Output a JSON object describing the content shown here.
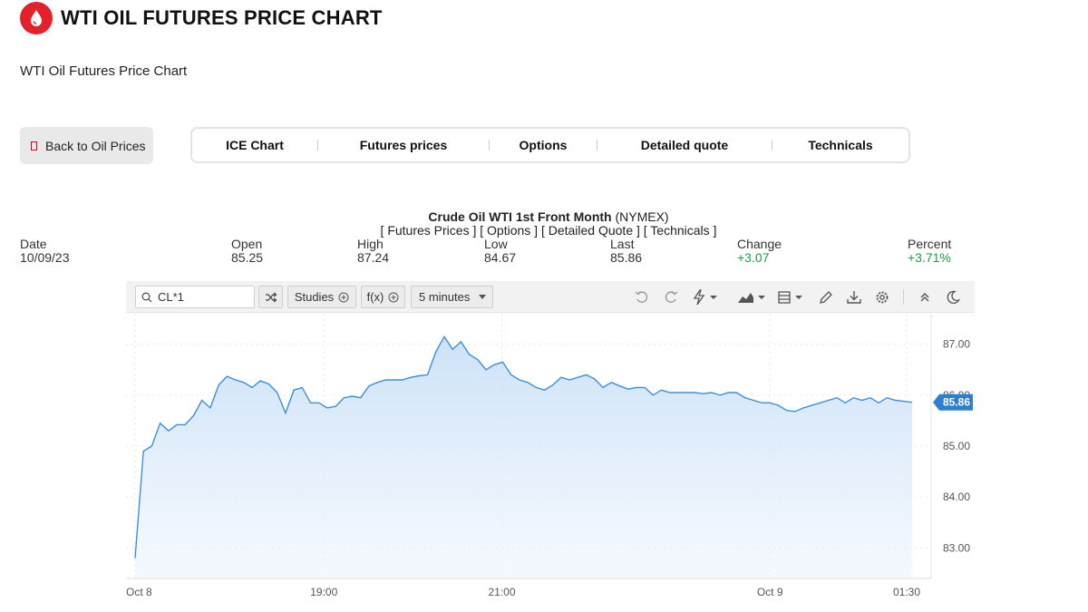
{
  "header": {
    "title": "WTI OIL FUTURES PRICE CHART",
    "subtitle": "WTI Oil Futures Price Chart",
    "logo_icon": "oil-drop-icon",
    "brand_color": "#e4202b"
  },
  "back_button": {
    "label": "Back to Oil Prices"
  },
  "tabs": [
    {
      "label": "ICE Chart"
    },
    {
      "label": "Futures prices"
    },
    {
      "label": "Options"
    },
    {
      "label": "Detailed quote"
    },
    {
      "label": "Technicals"
    }
  ],
  "quote": {
    "name": "Crude Oil WTI 1st Front Month",
    "exchange": "(NYMEX)",
    "links": "[ Futures Prices ] [ Options ] [ Detailed Quote ] [ Technicals ]",
    "columns": [
      {
        "label": "Date",
        "value": "10/09/23"
      },
      {
        "label": "Open",
        "value": "85.25"
      },
      {
        "label": "High",
        "value": "87.24"
      },
      {
        "label": "Low",
        "value": "84.67"
      },
      {
        "label": "Last",
        "value": "85.86"
      },
      {
        "label": "Change",
        "value": "+3.07"
      },
      {
        "label": "Percent",
        "value": "+3.71%"
      }
    ],
    "positive_color": "#1e9e4a"
  },
  "toolbar": {
    "symbol": "CL*1",
    "studies_label": "Studies",
    "fx_label": "f(x)",
    "interval_label": "5 minutes",
    "icons": [
      "search-icon",
      "shuffle-icon",
      "plus-circle-icon",
      "chevron-down-icon",
      "undo-icon",
      "redo-icon",
      "bolt-icon",
      "area-chart-icon",
      "template-icon",
      "pencil-icon",
      "download-icon",
      "gear-icon",
      "collapse-icon",
      "moon-icon"
    ]
  },
  "chart_data": {
    "type": "area",
    "title": "",
    "xlabel": "",
    "ylabel": "",
    "x_tick_labels": [
      "Oct 8",
      "19:00",
      "21:00",
      "Oct 9",
      "01:30"
    ],
    "y_tick_labels": [
      "87.00",
      "86.00",
      "85.00",
      "84.00",
      "83.00"
    ],
    "ylim": [
      82.4,
      87.6
    ],
    "last_value_label": "85.86",
    "line_color": "#3d8fd8",
    "fill_color": "#cfe4f8",
    "grid": true,
    "series": [
      {
        "values": [
          82.8,
          84.9,
          85.0,
          85.45,
          85.3,
          85.42,
          85.42,
          85.6,
          85.9,
          85.75,
          86.2,
          86.37,
          86.3,
          86.25,
          86.15,
          86.28,
          86.22,
          86.05,
          85.65,
          86.1,
          86.15,
          85.85,
          85.85,
          85.75,
          85.78,
          85.95,
          85.98,
          85.95,
          86.18,
          86.25,
          86.3,
          86.3,
          86.3,
          86.35,
          86.38,
          86.4,
          86.85,
          87.15,
          86.9,
          87.05,
          86.8,
          86.7,
          86.5,
          86.6,
          86.65,
          86.4,
          86.3,
          86.25,
          86.15,
          86.1,
          86.2,
          86.35,
          86.3,
          86.35,
          86.4,
          86.32,
          86.15,
          86.25,
          86.18,
          86.12,
          86.15,
          86.15,
          86.0,
          86.1,
          86.05,
          86.05,
          86.05,
          86.05,
          86.03,
          86.05,
          86.0,
          86.05,
          86.05,
          85.95,
          85.9,
          85.85,
          85.85,
          85.8,
          85.7,
          85.68,
          85.75,
          85.8,
          85.85,
          85.9,
          85.95,
          85.85,
          85.95,
          85.9,
          85.95,
          85.85,
          85.95,
          85.9,
          85.88,
          85.86
        ]
      }
    ]
  }
}
